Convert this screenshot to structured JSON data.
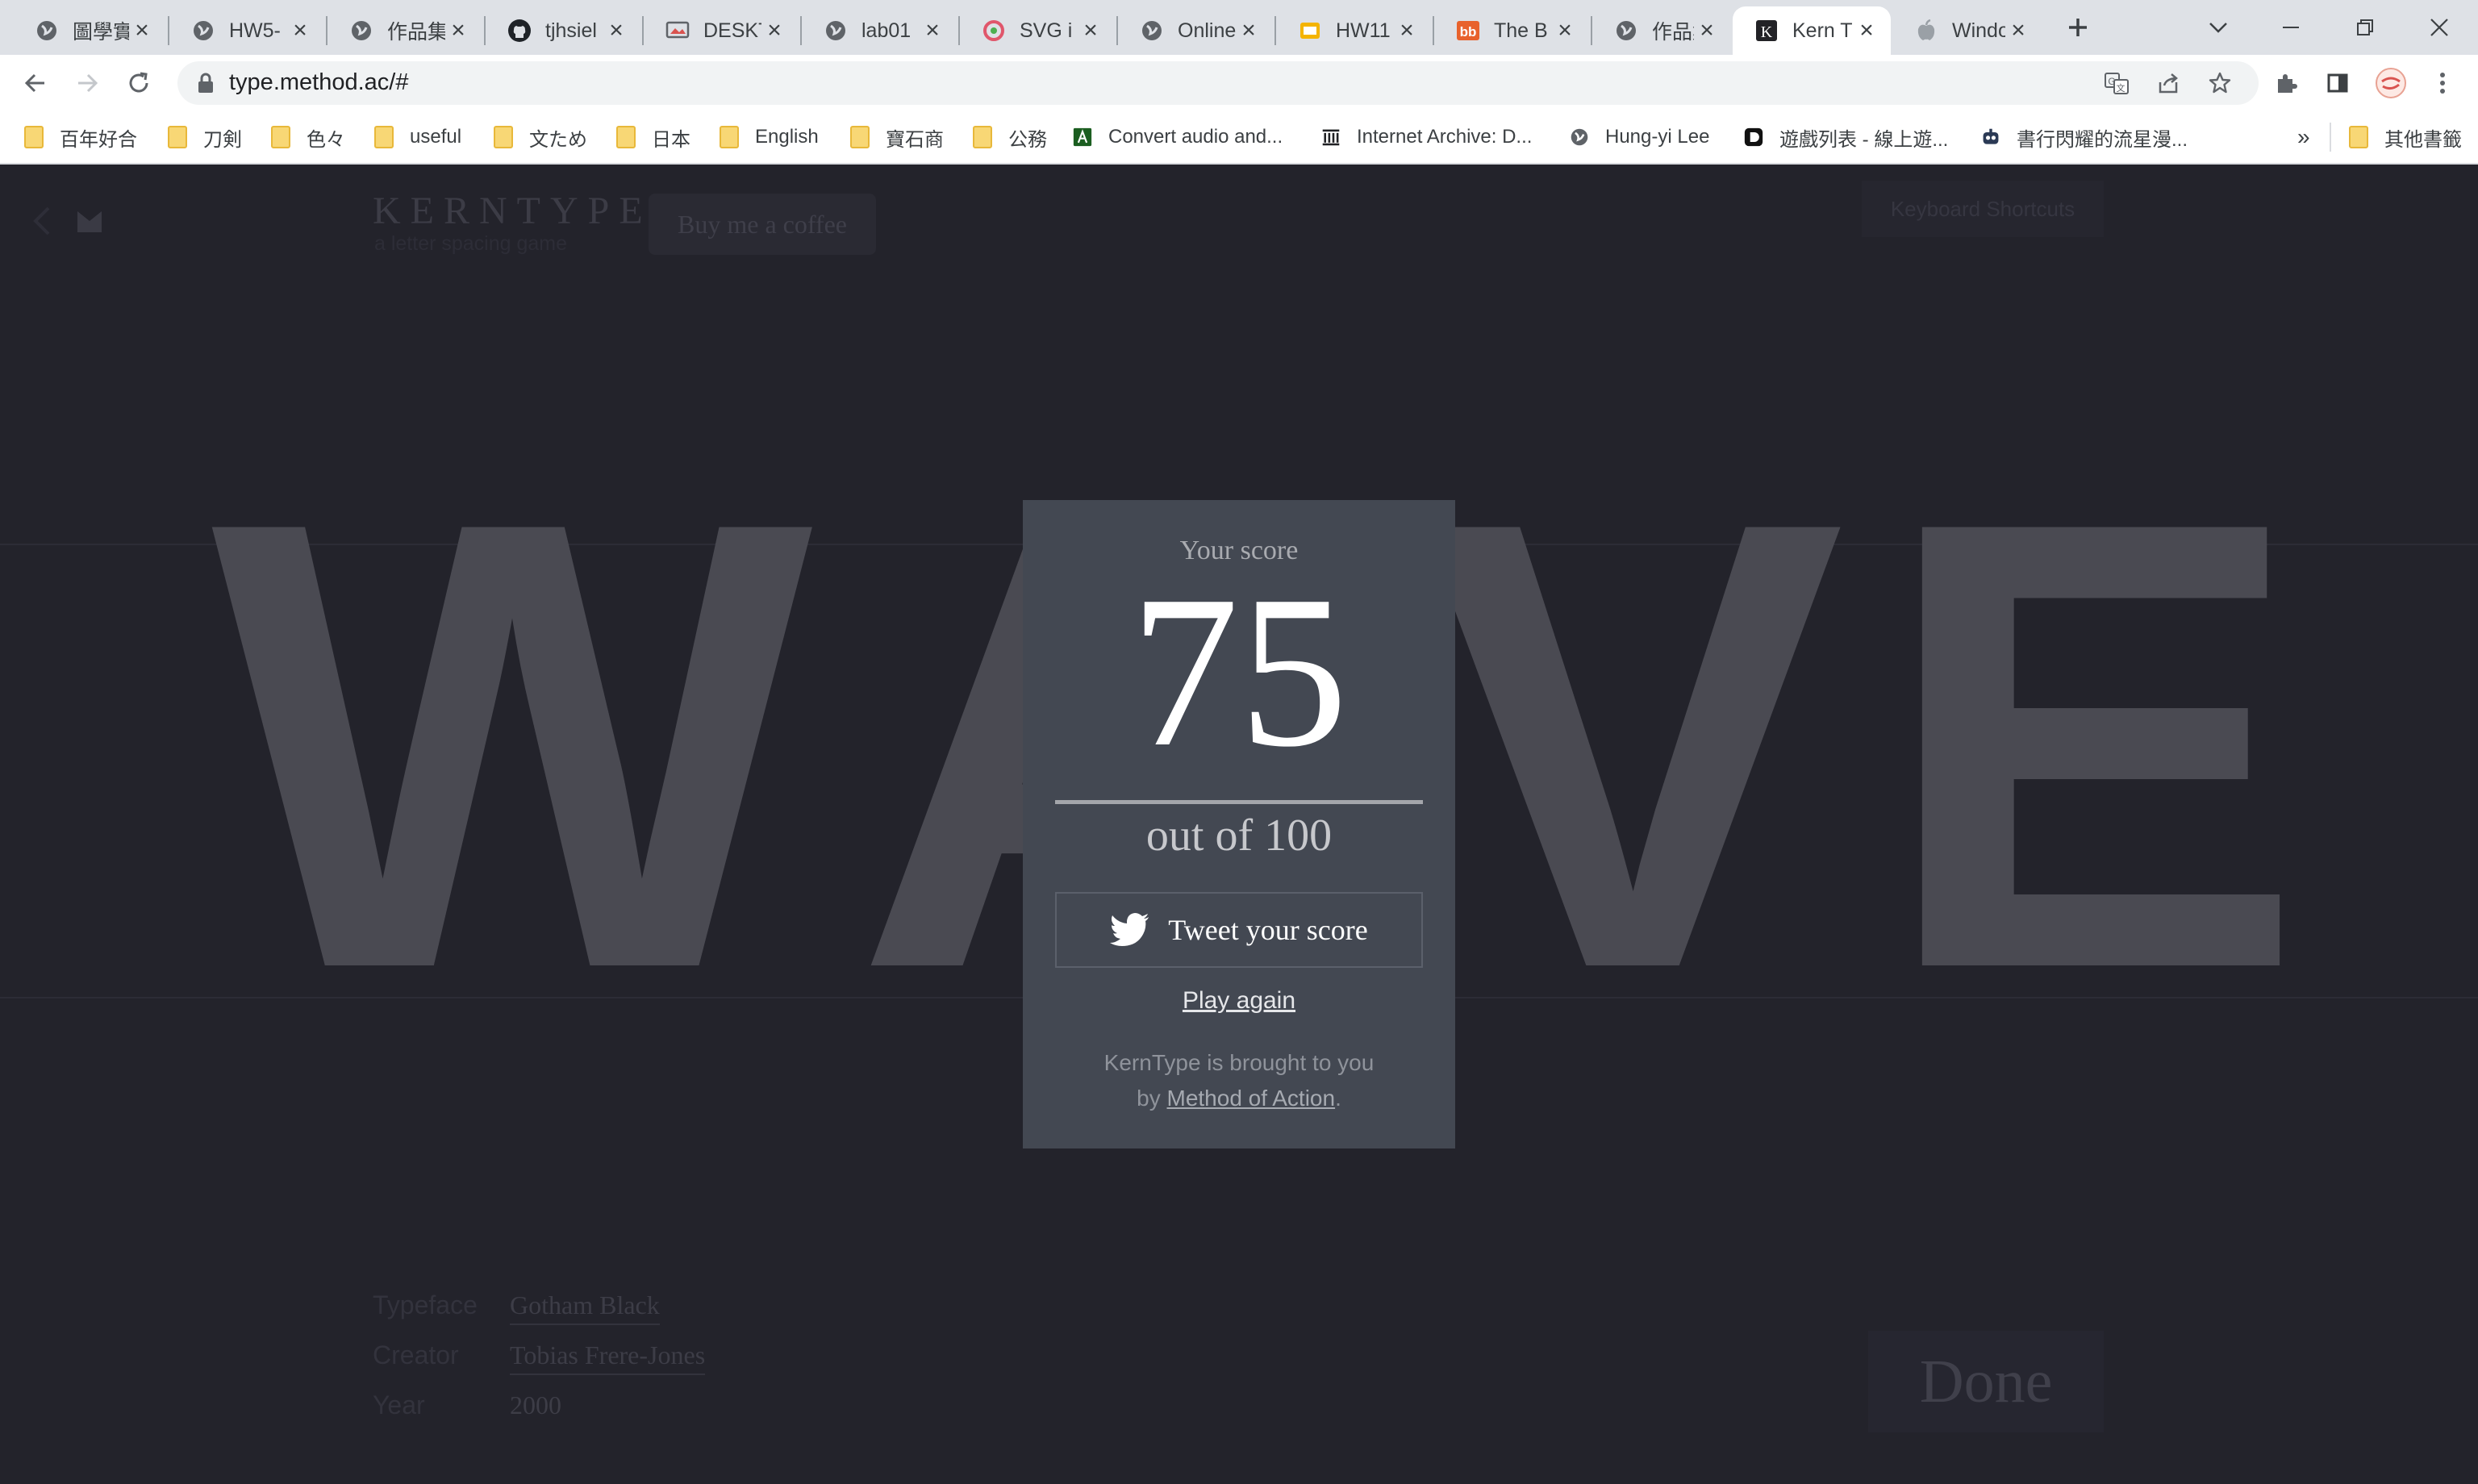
{
  "browser": {
    "tabs": [
      {
        "title": "圖學實",
        "icon": "globe-icon"
      },
      {
        "title": "HW5-",
        "icon": "globe-icon"
      },
      {
        "title": "作品集",
        "icon": "globe-icon"
      },
      {
        "title": "tjhsiel",
        "icon": "github-icon"
      },
      {
        "title": "DESKT",
        "icon": "desktop-app-icon"
      },
      {
        "title": "lab01",
        "icon": "globe-icon"
      },
      {
        "title": "SVG i",
        "icon": "svg-icon"
      },
      {
        "title": "Online",
        "icon": "globe-icon"
      },
      {
        "title": "HW11",
        "icon": "slides-icon"
      },
      {
        "title": "The B",
        "icon": "bb-icon"
      },
      {
        "title": "作品集",
        "icon": "globe-icon"
      },
      {
        "title": "Kern T",
        "icon": "k-icon",
        "active": true
      },
      {
        "title": "Windo",
        "icon": "apple-icon"
      }
    ],
    "url": "type.method.ac/#",
    "bookmarks": [
      {
        "label": "百年好合",
        "icon": "folder-icon"
      },
      {
        "label": "刀剣",
        "icon": "folder-icon"
      },
      {
        "label": "色々",
        "icon": "folder-icon"
      },
      {
        "label": "useful",
        "icon": "folder-icon"
      },
      {
        "label": "文ため",
        "icon": "folder-icon"
      },
      {
        "label": "日本",
        "icon": "folder-icon"
      },
      {
        "label": "English",
        "icon": "folder-icon"
      },
      {
        "label": "寶石商",
        "icon": "folder-icon"
      },
      {
        "label": "公務",
        "icon": "folder-icon"
      },
      {
        "label": "Convert audio and...",
        "icon": "convert-icon"
      },
      {
        "label": "Internet Archive: D...",
        "icon": "archive-icon"
      },
      {
        "label": "Hung-yi Lee",
        "icon": "globe-icon"
      },
      {
        "label": "遊戲列表 - 線上遊...",
        "icon": "d-icon"
      },
      {
        "label": "書行閃耀的流星漫...",
        "icon": "robot-icon"
      }
    ],
    "overflow_label": "»",
    "other_bookmarks": "其他書籤"
  },
  "page": {
    "logo": "KERNTYPE",
    "tagline": "a letter spacing game",
    "coffee_button": "Buy me a coffee",
    "shortcuts_button": "Keyboard Shortcuts",
    "word_letters": [
      "W",
      "A",
      "V",
      "E"
    ],
    "info": {
      "typeface_label": "Typeface",
      "typeface_value": "Gotham Black",
      "creator_label": "Creator",
      "creator_value": "Tobias Frere-Jones",
      "year_label": "Year",
      "year_value": "2000"
    },
    "done_button": "Done"
  },
  "modal": {
    "label": "Your score",
    "score": "75",
    "out_of": "out of 100",
    "tweet_button": "Tweet your score",
    "play_again": "Play again",
    "credit_line1": "KernType is brought to you",
    "credit_by": "by ",
    "credit_link": "Method of Action",
    "credit_end": "."
  }
}
